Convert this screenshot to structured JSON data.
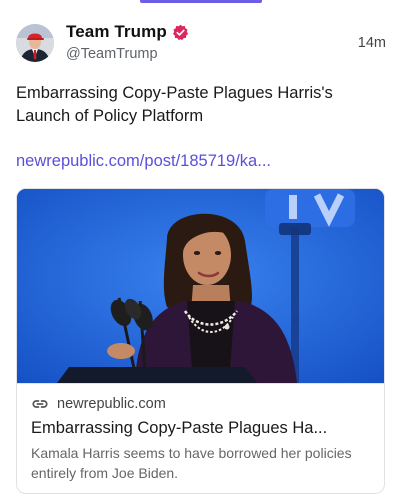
{
  "author": {
    "display_name": "Team Trump",
    "handle": "@TeamTrump",
    "verified": true
  },
  "timestamp": "14m",
  "post": {
    "text": "Embarrassing Copy-Paste Plagues Harris's Launch of Policy Platform",
    "link": "newrepublic.com/post/185719/ka..."
  },
  "link_card": {
    "domain": "newrepublic.com",
    "title": "Embarrassing Copy-Paste Plagues Ha...",
    "description": "Kamala Harris seems to have borrowed her policies entirely from Joe Biden."
  },
  "colors": {
    "accent": "#6c5ce7",
    "link": "#5b4fdb",
    "verified_badge": "#e0245e",
    "card_image_background": "#1f63d8"
  },
  "icons": [
    "verified-badge-icon",
    "link-icon"
  ]
}
